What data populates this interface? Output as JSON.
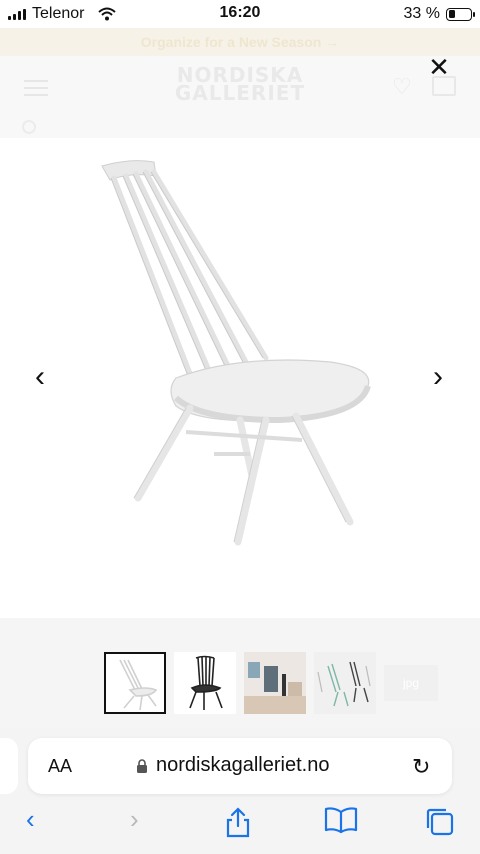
{
  "status_bar": {
    "carrier": "Telenor",
    "time": "16:20",
    "battery": "33 %",
    "battery_level": 0.33
  },
  "promo": {
    "text": "Organize for a New Season →"
  },
  "header": {
    "logo_line1": "NORDISKA",
    "logo_line2": "GALLERIET"
  },
  "modal": {
    "close_symbol": "✕",
    "prev_symbol": "‹",
    "next_symbol": "›"
  },
  "thumbnails": [
    {
      "name": "white-chair",
      "active": true
    },
    {
      "name": "black-chair",
      "active": false
    },
    {
      "name": "room-scene",
      "active": false
    },
    {
      "name": "chairs-group",
      "active": false
    },
    {
      "name": "more",
      "active": false,
      "label": "jpg"
    }
  ],
  "browser": {
    "aa": "AA",
    "url": "nordiskagalleriet.no"
  },
  "toolbar": {
    "back": "‹",
    "forward": "›"
  },
  "colors": {
    "accent": "#1a73e8"
  }
}
